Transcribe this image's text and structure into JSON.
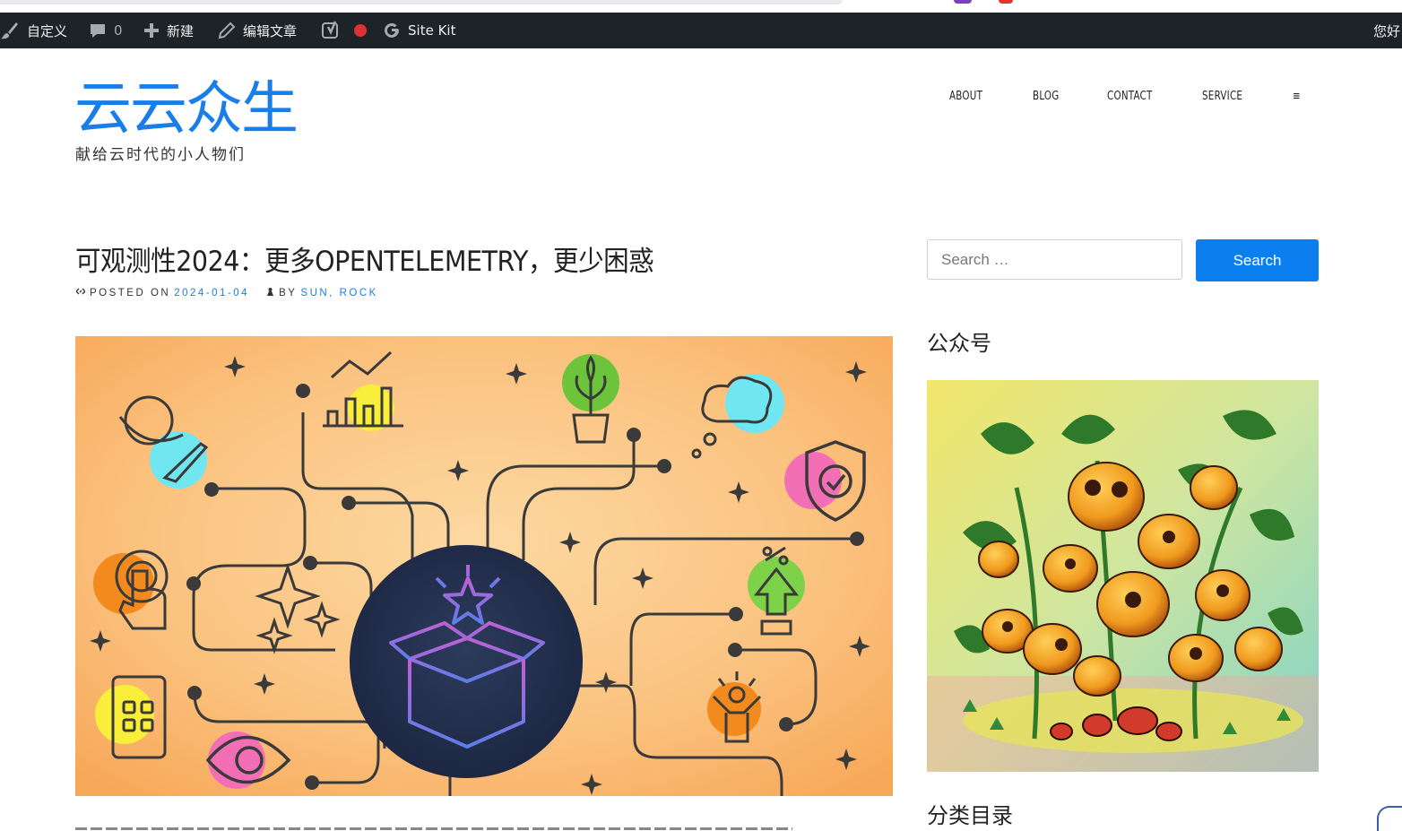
{
  "admin_bar": {
    "customize": "自定义",
    "comments_count": "0",
    "new": "新建",
    "edit_post": "编辑文章",
    "site_kit": "Site Kit",
    "greeting": "您好"
  },
  "site": {
    "title": "云云众生",
    "tagline": "献给云时代的小人物们"
  },
  "nav": {
    "items": [
      "ABOUT",
      "BLOG",
      "CONTACT",
      "SERVICE"
    ],
    "more": "≡"
  },
  "post": {
    "title": "可观测性2024：更多OPENTELEMETRY，更少困惑",
    "posted_on_label": "POSTED ON",
    "date": "2024-01-04",
    "by_label": "BY",
    "authors": "SUN, ROCK"
  },
  "sidebar": {
    "search_placeholder": "Search …",
    "search_button": "Search",
    "widget_wechat_title": "公众号",
    "widget_categories_title": "分类目录"
  },
  "colors": {
    "admin_bar_bg": "#1d2327",
    "accent": "#1a7ee8",
    "button": "#0b7ff0",
    "feature_bg": "#f9b66a"
  }
}
